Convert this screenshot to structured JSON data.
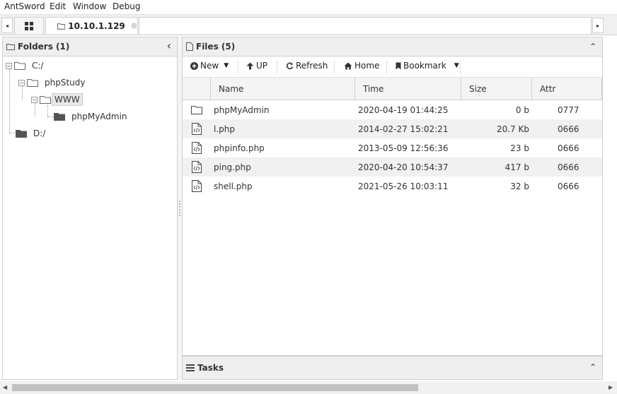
{
  "menu": {
    "items": [
      "AntSword",
      "Edit",
      "Window",
      "Debug"
    ]
  },
  "tabs": {
    "left_arrow": "◂",
    "right_arrow": "▸",
    "home_icon": "grid-icon",
    "active_tab_label": "10.10.1.129",
    "close_glyph": "⊗"
  },
  "folders": {
    "title": "Folders (1)",
    "collapse": "‹",
    "tree": [
      {
        "label": "C:/",
        "icon": "folder-outline-icon"
      },
      {
        "label": "phpStudy",
        "icon": "folder-outline-icon"
      },
      {
        "label": "WWW",
        "icon": "folder-outline-icon",
        "selected": true
      },
      {
        "label": "phpMyAdmin",
        "icon": "folder-filled-icon"
      },
      {
        "label": "D:/",
        "icon": "folder-filled-icon"
      }
    ]
  },
  "files": {
    "title": "Files (5)",
    "collapse": "⌃",
    "toolbar": {
      "new": "New",
      "up": "UP",
      "refresh": "Refresh",
      "home": "Home",
      "bookmark": "Bookmark"
    },
    "columns": [
      "Name",
      "Time",
      "Size",
      "Attr"
    ],
    "rows": [
      {
        "name": "phpMyAdmin",
        "time": "2020-04-19 01:44:25",
        "size": "0 b",
        "attr": "0777",
        "type": "folder"
      },
      {
        "name": "l.php",
        "time": "2014-02-27 15:02:21",
        "size": "20.7 Kb",
        "attr": "0666",
        "type": "file"
      },
      {
        "name": "phpinfo.php",
        "time": "2013-05-09 12:56:36",
        "size": "23 b",
        "attr": "0666",
        "type": "file"
      },
      {
        "name": "ping.php",
        "time": "2020-04-20 10:54:37",
        "size": "417 b",
        "attr": "0666",
        "type": "file"
      },
      {
        "name": "shell.php",
        "time": "2021-05-26 10:03:11",
        "size": "32 b",
        "attr": "0666",
        "type": "file"
      }
    ]
  },
  "tasks": {
    "title": "Tasks",
    "collapse": "⌃"
  },
  "colors": {
    "header_bg": "#efefef",
    "border": "#cfcfcf",
    "row_alt": "#f1f1f1",
    "scroll_thumb": "#c1c1c1"
  }
}
